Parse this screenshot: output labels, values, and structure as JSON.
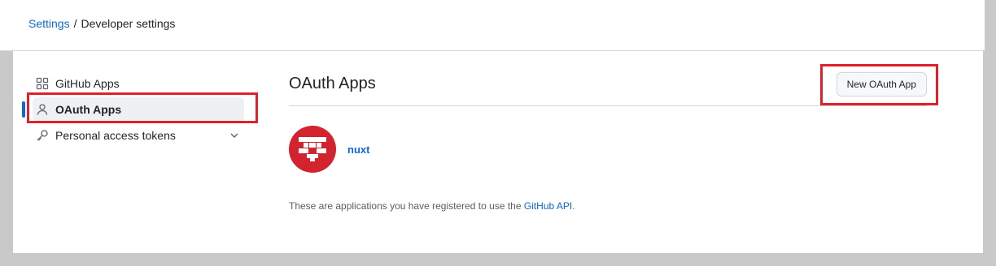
{
  "breadcrumb": {
    "parent": "Settings",
    "separator": "/",
    "current": "Developer settings"
  },
  "sidebar": {
    "items": [
      {
        "label": "GitHub Apps",
        "icon": "apps-grid-icon",
        "active": false
      },
      {
        "label": "OAuth Apps",
        "icon": "person-icon",
        "active": true
      },
      {
        "label": "Personal access tokens",
        "icon": "key-icon",
        "active": false,
        "expandable": true
      }
    ]
  },
  "main": {
    "title": "OAuth Apps",
    "new_button": "New OAuth App",
    "apps": [
      {
        "name": "nuxt"
      }
    ],
    "footnote_prefix": "These are applications you have registered to use the ",
    "footnote_link": "GitHub API",
    "footnote_suffix": "."
  },
  "colors": {
    "accent": "#0969da",
    "highlight": "#e0202a",
    "app_avatar": "#d2232f"
  }
}
